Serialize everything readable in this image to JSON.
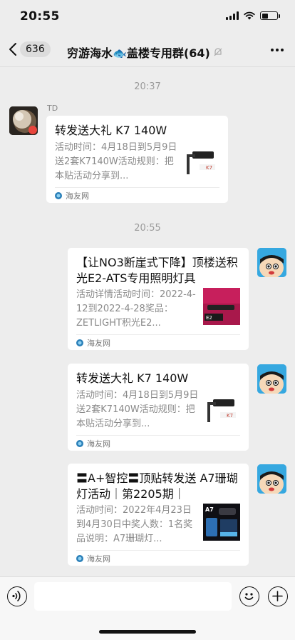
{
  "status_bar": {
    "time": "20:55",
    "icons": [
      "signal-icon",
      "wifi-icon",
      "battery-icon"
    ],
    "battery_level": 0.4
  },
  "nav": {
    "back_badge": "636",
    "title": "穷游海水🐟盖楼专用群(64)",
    "icons": [
      "back-icon",
      "mute-icon",
      "more-icon"
    ]
  },
  "chat": {
    "time_1": "20:37",
    "time_2": "20:55",
    "messages": [
      {
        "sender": "TD",
        "side": "left",
        "title": "转发送大礼 K7 140W",
        "desc": "活动时间：4月18日到5月9日送2套K7140W活动规则：把本贴活动分享到...",
        "source": "海友网",
        "thumb": "k7-light-thumb"
      },
      {
        "sender": "",
        "side": "right",
        "title": "【让NO3断崖式下降】顶楼送积光E2-ATS专用照明灯具",
        "desc": "活动详情活动时间：2022-4-12到2022-4-28奖品：ZETLIGHT积光E2...",
        "source": "海友网",
        "thumb": "e2-light-thumb"
      },
      {
        "sender": "",
        "side": "right",
        "title": "转发送大礼 K7 140W",
        "desc": "活动时间：4月18日到5月9日送2套K7140W活动规则：把本贴活动分享到...",
        "source": "海友网",
        "thumb": "k7-light-thumb"
      },
      {
        "sender": "",
        "side": "right",
        "title": "〓A+智控〓顶贴转发送 A7珊瑚灯活动｜第2205期｜",
        "desc": "活动时间：2022年4月23日到4月30日中奖人数：1名奖品说明：A7珊瑚灯...",
        "source": "海友网",
        "thumb": "a7-light-thumb"
      }
    ]
  },
  "input_bar": {
    "placeholder": "",
    "icons": [
      "voice-icon",
      "emoji-icon",
      "plus-icon"
    ]
  },
  "colors": {
    "background": "#ededed",
    "card": "#ffffff",
    "self_avatar": "#36a8e0",
    "muted_text": "#8a8a8a"
  }
}
